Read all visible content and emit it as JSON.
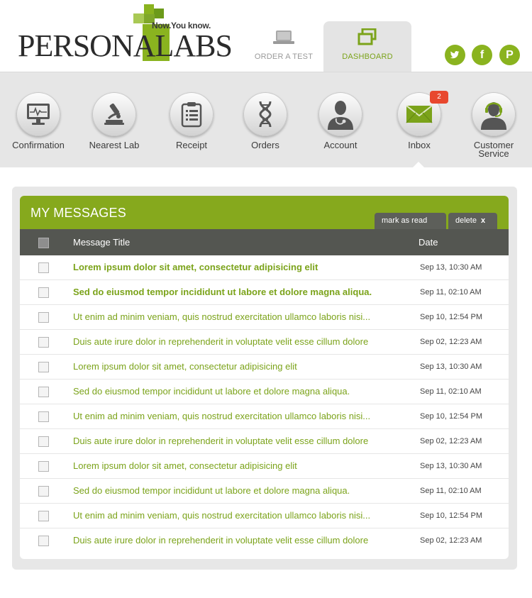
{
  "brand": {
    "name": "PERSONALABS",
    "tagline": "Now.You know."
  },
  "top_tabs": [
    {
      "label": "ORDER A TEST",
      "icon": "laptop-icon",
      "active": false
    },
    {
      "label": "DASHBOARD",
      "icon": "windows-icon",
      "active": true
    }
  ],
  "social": [
    {
      "name": "twitter-icon",
      "glyph": "🐦"
    },
    {
      "name": "facebook-icon",
      "glyph": "f"
    },
    {
      "name": "pinterest-icon",
      "glyph": "P"
    }
  ],
  "nav": {
    "items": [
      {
        "label": "Confirmation",
        "icon": "monitor-icon"
      },
      {
        "label": "Nearest Lab",
        "icon": "microscope-icon"
      },
      {
        "label": "Receipt",
        "icon": "clipboard-icon"
      },
      {
        "label": "Orders",
        "icon": "dna-icon"
      },
      {
        "label": "Account",
        "icon": "doctor-icon"
      },
      {
        "label": "Inbox",
        "icon": "envelope-icon",
        "badge": "2",
        "active": true
      },
      {
        "label": "Customer Service",
        "icon": "headset-icon"
      }
    ]
  },
  "messages": {
    "title": "MY MESSAGES",
    "mark_as_read_label": "mark as read",
    "delete_label": "delete",
    "delete_glyph": "x",
    "columns": {
      "title": "Message Title",
      "date": "Date"
    },
    "rows": [
      {
        "title": "Lorem ipsum dolor sit amet, consectetur adipisicing elit",
        "date": "Sep 13, 10:30 AM",
        "unread": true
      },
      {
        "title": "Sed do eiusmod tempor incididunt ut labore et dolore magna aliqua.",
        "date": "Sep 11, 02:10 AM",
        "unread": true
      },
      {
        "title": "Ut enim ad minim veniam, quis nostrud exercitation ullamco laboris nisi...",
        "date": "Sep 10, 12:54 PM",
        "unread": false
      },
      {
        "title": "Duis aute irure dolor in reprehenderit in voluptate velit esse cillum dolore",
        "date": "Sep 02, 12:23 AM",
        "unread": false
      },
      {
        "title": "Lorem ipsum dolor sit amet, consectetur adipisicing elit",
        "date": "Sep 13, 10:30 AM",
        "unread": false
      },
      {
        "title": "Sed do eiusmod tempor incididunt ut labore et dolore magna aliqua.",
        "date": "Sep 11, 02:10 AM",
        "unread": false
      },
      {
        "title": "Ut enim ad minim veniam, quis nostrud exercitation ullamco laboris nisi...",
        "date": "Sep 10, 12:54 PM",
        "unread": false
      },
      {
        "title": "Duis aute irure dolor in reprehenderit in voluptate velit esse cillum dolore",
        "date": "Sep 02, 12:23 AM",
        "unread": false
      },
      {
        "title": "Lorem ipsum dolor sit amet, consectetur adipisicing elit",
        "date": "Sep 13, 10:30 AM",
        "unread": false
      },
      {
        "title": "Sed do eiusmod tempor incididunt ut labore et dolore magna aliqua.",
        "date": "Sep 11, 02:10 AM",
        "unread": false
      },
      {
        "title": "Ut enim ad minim veniam, quis nostrud exercitation ullamco laboris nisi...",
        "date": "Sep 10, 12:54 PM",
        "unread": false
      },
      {
        "title": "Duis aute irure dolor in reprehenderit in voluptate velit esse cillum dolore",
        "date": "Sep 02, 12:23 AM",
        "unread": false
      }
    ]
  },
  "colors": {
    "brand_green": "#86a91d",
    "header_dark": "#545651",
    "badge_red": "#e8482e"
  }
}
